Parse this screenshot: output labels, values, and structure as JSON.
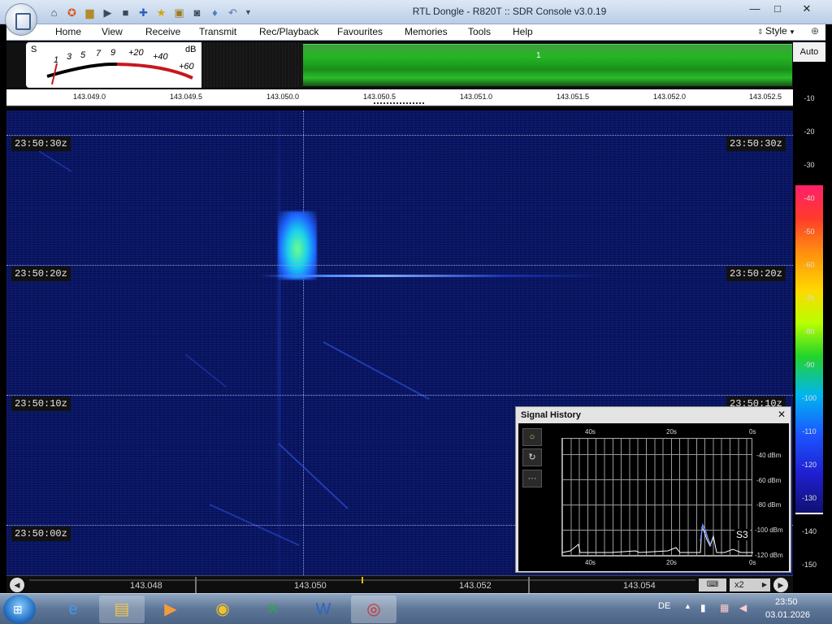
{
  "window": {
    "title": "RTL Dongle - R820T :: SDR Console v3.0.19",
    "minimize": "—",
    "maximize": "□",
    "close": "✕"
  },
  "menu": {
    "items": [
      "Home",
      "View",
      "Receive",
      "Transmit",
      "Rec/Playback",
      "Favourites",
      "Memories",
      "Tools",
      "Help"
    ],
    "style": "Style"
  },
  "smeter": {
    "labels": [
      "S",
      "1",
      "3",
      "5",
      "7",
      "9",
      "+20",
      "+40",
      "+60",
      "dB"
    ]
  },
  "channel": {
    "label": "1"
  },
  "frequency_scale": [
    "143.049.0",
    "143.049.5",
    "143.050.0",
    "143.050.5",
    "143.051.0",
    "143.051.5",
    "143.052.0",
    "143.052.5"
  ],
  "waterfall": {
    "time_labels": [
      "23:50:30z",
      "23:50:20z",
      "23:50:10z",
      "23:50:00z"
    ]
  },
  "level_scale": {
    "auto": "Auto",
    "levels": [
      "-10",
      "-20",
      "-30",
      "-40",
      "-50",
      "-60",
      "-70",
      "-80",
      "-90",
      "-100",
      "-110",
      "-120",
      "-130",
      "-140",
      "-150"
    ]
  },
  "tuning_strip": {
    "ticks": [
      "143.048",
      "143.050",
      "143.052",
      "143.054"
    ],
    "zoom": "x2"
  },
  "signal_history": {
    "title": "Signal History",
    "close": "✕",
    "top_axis": [
      "40s",
      "20s",
      "0s"
    ],
    "bottom_axis": [
      "40s",
      "20s",
      "0s"
    ],
    "y_axis": [
      "-40 dBm",
      "-60 dBm",
      "-80 dBm",
      "-100 dBm",
      "-120 dBm"
    ],
    "reading": "S3",
    "buttons": [
      "○",
      "↻",
      "···"
    ]
  },
  "taskbar": {
    "language": "DE",
    "time": "23:50",
    "date": "03.01.2026"
  },
  "colors": {
    "waterfall_bg": "#061257",
    "channel_green": "#24b624",
    "signal_green": "#6dff8a",
    "signal_cyan": "#1ad0ee"
  }
}
